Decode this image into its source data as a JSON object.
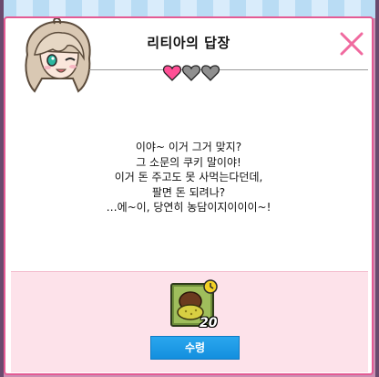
{
  "dialog": {
    "title": "리티아의 답장",
    "affection_hearts": {
      "filled": 1,
      "total": 3
    },
    "message_lines": [
      "이야~ 이거 그거 맞지?",
      "그 소문의 쿠키 말이야!",
      "이거 돈 주고도 못 사먹는다던데,",
      "팔면 돈 되려나?",
      "…에~이, 당연히 농담이지이이이~!"
    ],
    "reward": {
      "item_icon": "cookie-item-icon",
      "quantity": "20",
      "claim_label": "수령"
    }
  },
  "colors": {
    "border_pink": "#e45b94",
    "close_pink": "#f06a9f",
    "heart_pink": "#ff4f95",
    "heart_gray": "#8f8f8f",
    "panel_pink": "#fde2ea",
    "button_blue": "#1b9be6"
  }
}
